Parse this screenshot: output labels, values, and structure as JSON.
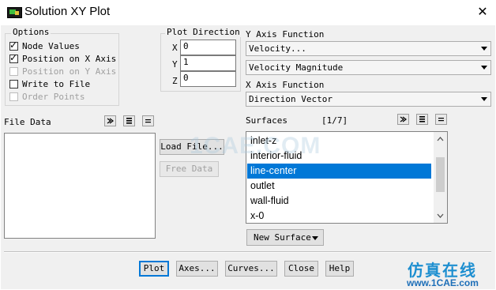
{
  "window": {
    "title": "Solution XY Plot"
  },
  "options": {
    "legend": "Options",
    "items": [
      {
        "label": "Node Values",
        "checked": true,
        "enabled": true
      },
      {
        "label": "Position on X Axis",
        "checked": true,
        "enabled": true
      },
      {
        "label": "Position on Y Axis",
        "checked": false,
        "enabled": false
      },
      {
        "label": "Write to File",
        "checked": false,
        "enabled": true
      },
      {
        "label": "Order Points",
        "checked": false,
        "enabled": false
      }
    ]
  },
  "plot_direction": {
    "legend": "Plot Direction",
    "x_label": "X",
    "x_value": "0",
    "y_label": "Y",
    "y_value": "1",
    "z_label": "Z",
    "z_value": "0"
  },
  "y_axis": {
    "label": "Y Axis Function",
    "category": "Velocity...",
    "quantity": "Velocity Magnitude"
  },
  "x_axis": {
    "label": "X Axis Function",
    "value": "Direction Vector"
  },
  "file_data": {
    "label": "File Data",
    "load_button": "Load File...",
    "free_button": "Free Data"
  },
  "surfaces": {
    "label": "Surfaces",
    "count": "[1/7]",
    "items": [
      "inlet-z",
      "interior-fluid",
      "line-center",
      "outlet",
      "wall-fluid",
      "x-0"
    ],
    "selected_index": 2,
    "new_surface": "New Surface"
  },
  "buttons": {
    "plot": "Plot",
    "axes": "Axes...",
    "curves": "Curves...",
    "close": "Close",
    "help": "Help"
  },
  "watermark": {
    "center": "1CAE.COM",
    "brand_cn": "仿真在线",
    "brand_url": "www.1CAE.com"
  },
  "colors": {
    "selection": "#0078d7",
    "dialog_bg": "#f0f0f0",
    "watermark_blue": "#1e8fd0"
  }
}
